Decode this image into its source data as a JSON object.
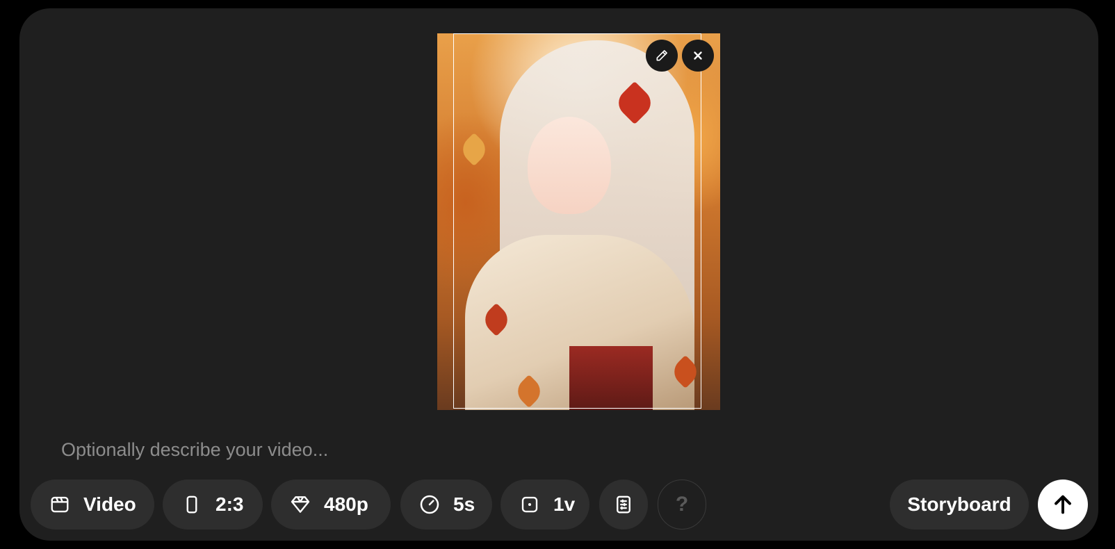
{
  "prompt": {
    "placeholder": "Optionally describe your video...",
    "value": ""
  },
  "attachment": {
    "image_subject": "anime girl with long white hair in kimono among autumn maple leaves",
    "edit_icon": "pencil-icon",
    "remove_icon": "close-icon"
  },
  "toolbar": {
    "type": {
      "label": "Video",
      "icon": "clapperboard-icon"
    },
    "aspect_ratio": {
      "label": "2:3",
      "icon": "portrait-phone-icon"
    },
    "resolution": {
      "label": "480p",
      "icon": "diamond-icon"
    },
    "duration": {
      "label": "5s",
      "icon": "timer-icon"
    },
    "variations": {
      "label": "1v",
      "icon": "square-dot-icon"
    },
    "presets": {
      "icon": "preset-list-icon"
    },
    "help": {
      "label": "?",
      "icon": "help-icon"
    },
    "storyboard": {
      "label": "Storyboard"
    },
    "submit": {
      "icon": "arrow-up-icon"
    }
  },
  "colors": {
    "background": "#000000",
    "panel": "#1f1f1f",
    "pill": "#2e2e2e",
    "submit": "#ffffff"
  }
}
